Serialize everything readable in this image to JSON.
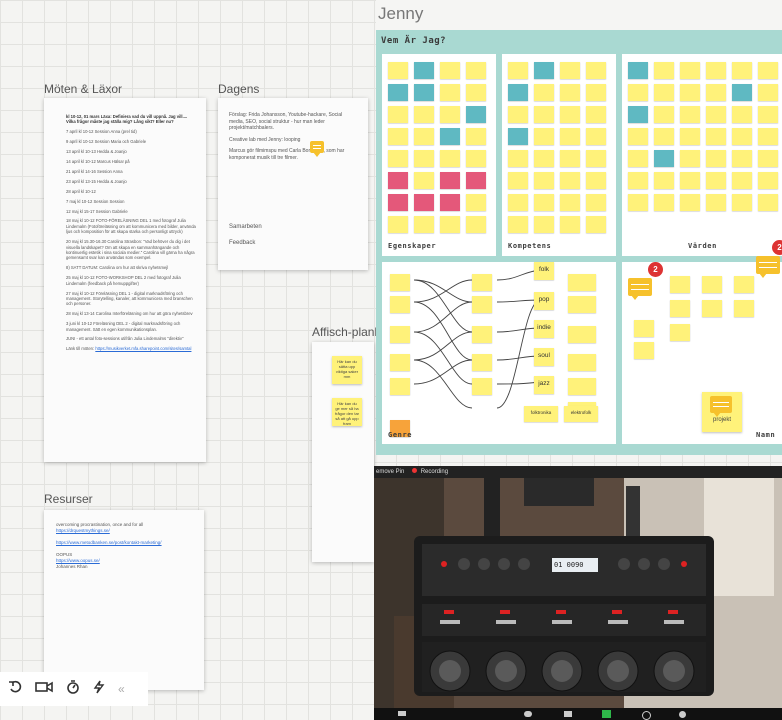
{
  "board": {
    "moten": {
      "title": "Möten & Läxor",
      "heading_lines": [
        "kl 10-12, 01 mars",
        "Läxa: Definiera vad du vill uppnå. Jag vill.... Vilka frågor måste jag ställa mig? Lång sikt? Eller nu?"
      ],
      "lines": [
        "7 april kl 10-12 Session Anna (prel tid)",
        "9 april kl 10-12 Session Maria och Gabriele",
        "13 april kl 10-13 Hedda & Joanjo",
        "14 april kl 10-12 Marcus Hälsa! på",
        "21 april kl 14-16 Session Anna",
        "23 april kl 13-15 Hedda & Joanjo",
        "28 april kl 10-12",
        "7 maj kl 10-12 Session Session",
        "12 maj kl 15-17 Session Gabriele",
        "18 maj kl 10-12 FOTO-FÖRELÄSNING DEL 1 med fotograf Julia Lindemalm (Fotoföreläsning om att kommunicera med bilder, använda ljus och komposition för att skapa starka och personligt uttryck)",
        "20 maj kl 15.30-16.30 Carolina Strasbon: \"Vad behöver du dig i det visuella landskapet? Om att skapa en sammanhängande och kontinuerlig estetik i sina sociala medier.\" Carolina vill gärna ha några gemensamt svar kan användas som exempel.",
        "8) SATT DATUM: Carolina om hur att skriva nyhetsmejl",
        "25 maj kl 10-12 FOTO-WORKSHOP DEL 2 med fotograf Julia Lindemalm (feedback på hemuppgifter)",
        "27 maj kl 10-12 Föreläsning DEL 1 - digital marknadsföring och management. Storytelling, kanaler, att kommunicera med branschen och personer.",
        "28 maj kl 13-14 Carolina Interföreläsning om hur att göra nyhetsbrev",
        "3 juni kl 10-12 Föreläsning DEL 2 - digital marknadsföring och management. Sätt en egen kommunikationsplan.",
        "JUNI - ett antal foto-sessions utifrån Julia Lindemalms \"direktiv\""
      ],
      "link_prefix": "Länk till möten:",
      "link": "https://musikverket.mfa.sharepoint.com/sites/samtal"
    },
    "dagens": {
      "title": "Dagens",
      "p1": "Förslag: Frida Johansson, Youtube-hackare, Social media, SEO, social struktur - hur man leder projekt/matchbalers.",
      "p2": "Creative lab med Jenny: looping",
      "p3": "Marcus gör filmimspu med Carla Boronska, som har komponerat musik till tre filmer.",
      "item1": "Samarbeten",
      "item2": "Feedback"
    },
    "affisch": {
      "title": "Affisch-plank",
      "note1": "Här kan du sätta upp viktiga saker mm",
      "note2": "Här kan du ge mer så ha frågor den tar så att gå upp fram"
    },
    "resurser": {
      "title": "Resurser",
      "line1": "overcoming procrastination, once and for all",
      "link1": "https://drquestmythings.se/",
      "link2": "https://www.metodbanken.se/post/kontakt-marketing/",
      "label3": "OOPUS",
      "link3": "https://www.oopus.se/",
      "line4": "Johannes Rhan"
    },
    "toolbar": {
      "icons": [
        "undo-icon",
        "video-icon",
        "timer-icon",
        "lightning-icon",
        "collapse-icon"
      ],
      "collapse_glyph": "«"
    }
  },
  "jenny": {
    "title": "Jenny",
    "frame_title": "Vem Är Jag?",
    "labels": {
      "egenskaper": "Egenskaper",
      "kompetens": "Kompetens",
      "varden": "Värden",
      "genre": "Genre",
      "namn": "Namn"
    },
    "genre_words": [
      "folk",
      "pop",
      "indie",
      "soul",
      "jazz"
    ],
    "genre_right": [
      "folktronika",
      "elektrofolk"
    ],
    "badges": [
      "2",
      "2"
    ],
    "corner_notes": [
      "projekt"
    ]
  },
  "video": {
    "left_label": "emove Pin",
    "right_label": "Recording",
    "screen_text": "01 0090"
  },
  "colors": {
    "sticky": "#fff27a",
    "teal": "#5fb9c2",
    "pink": "#e4587a",
    "orange": "#f7a33a",
    "frame": "#a9d9d2",
    "comment": "#f6c12c",
    "badge": "#dd3333"
  }
}
